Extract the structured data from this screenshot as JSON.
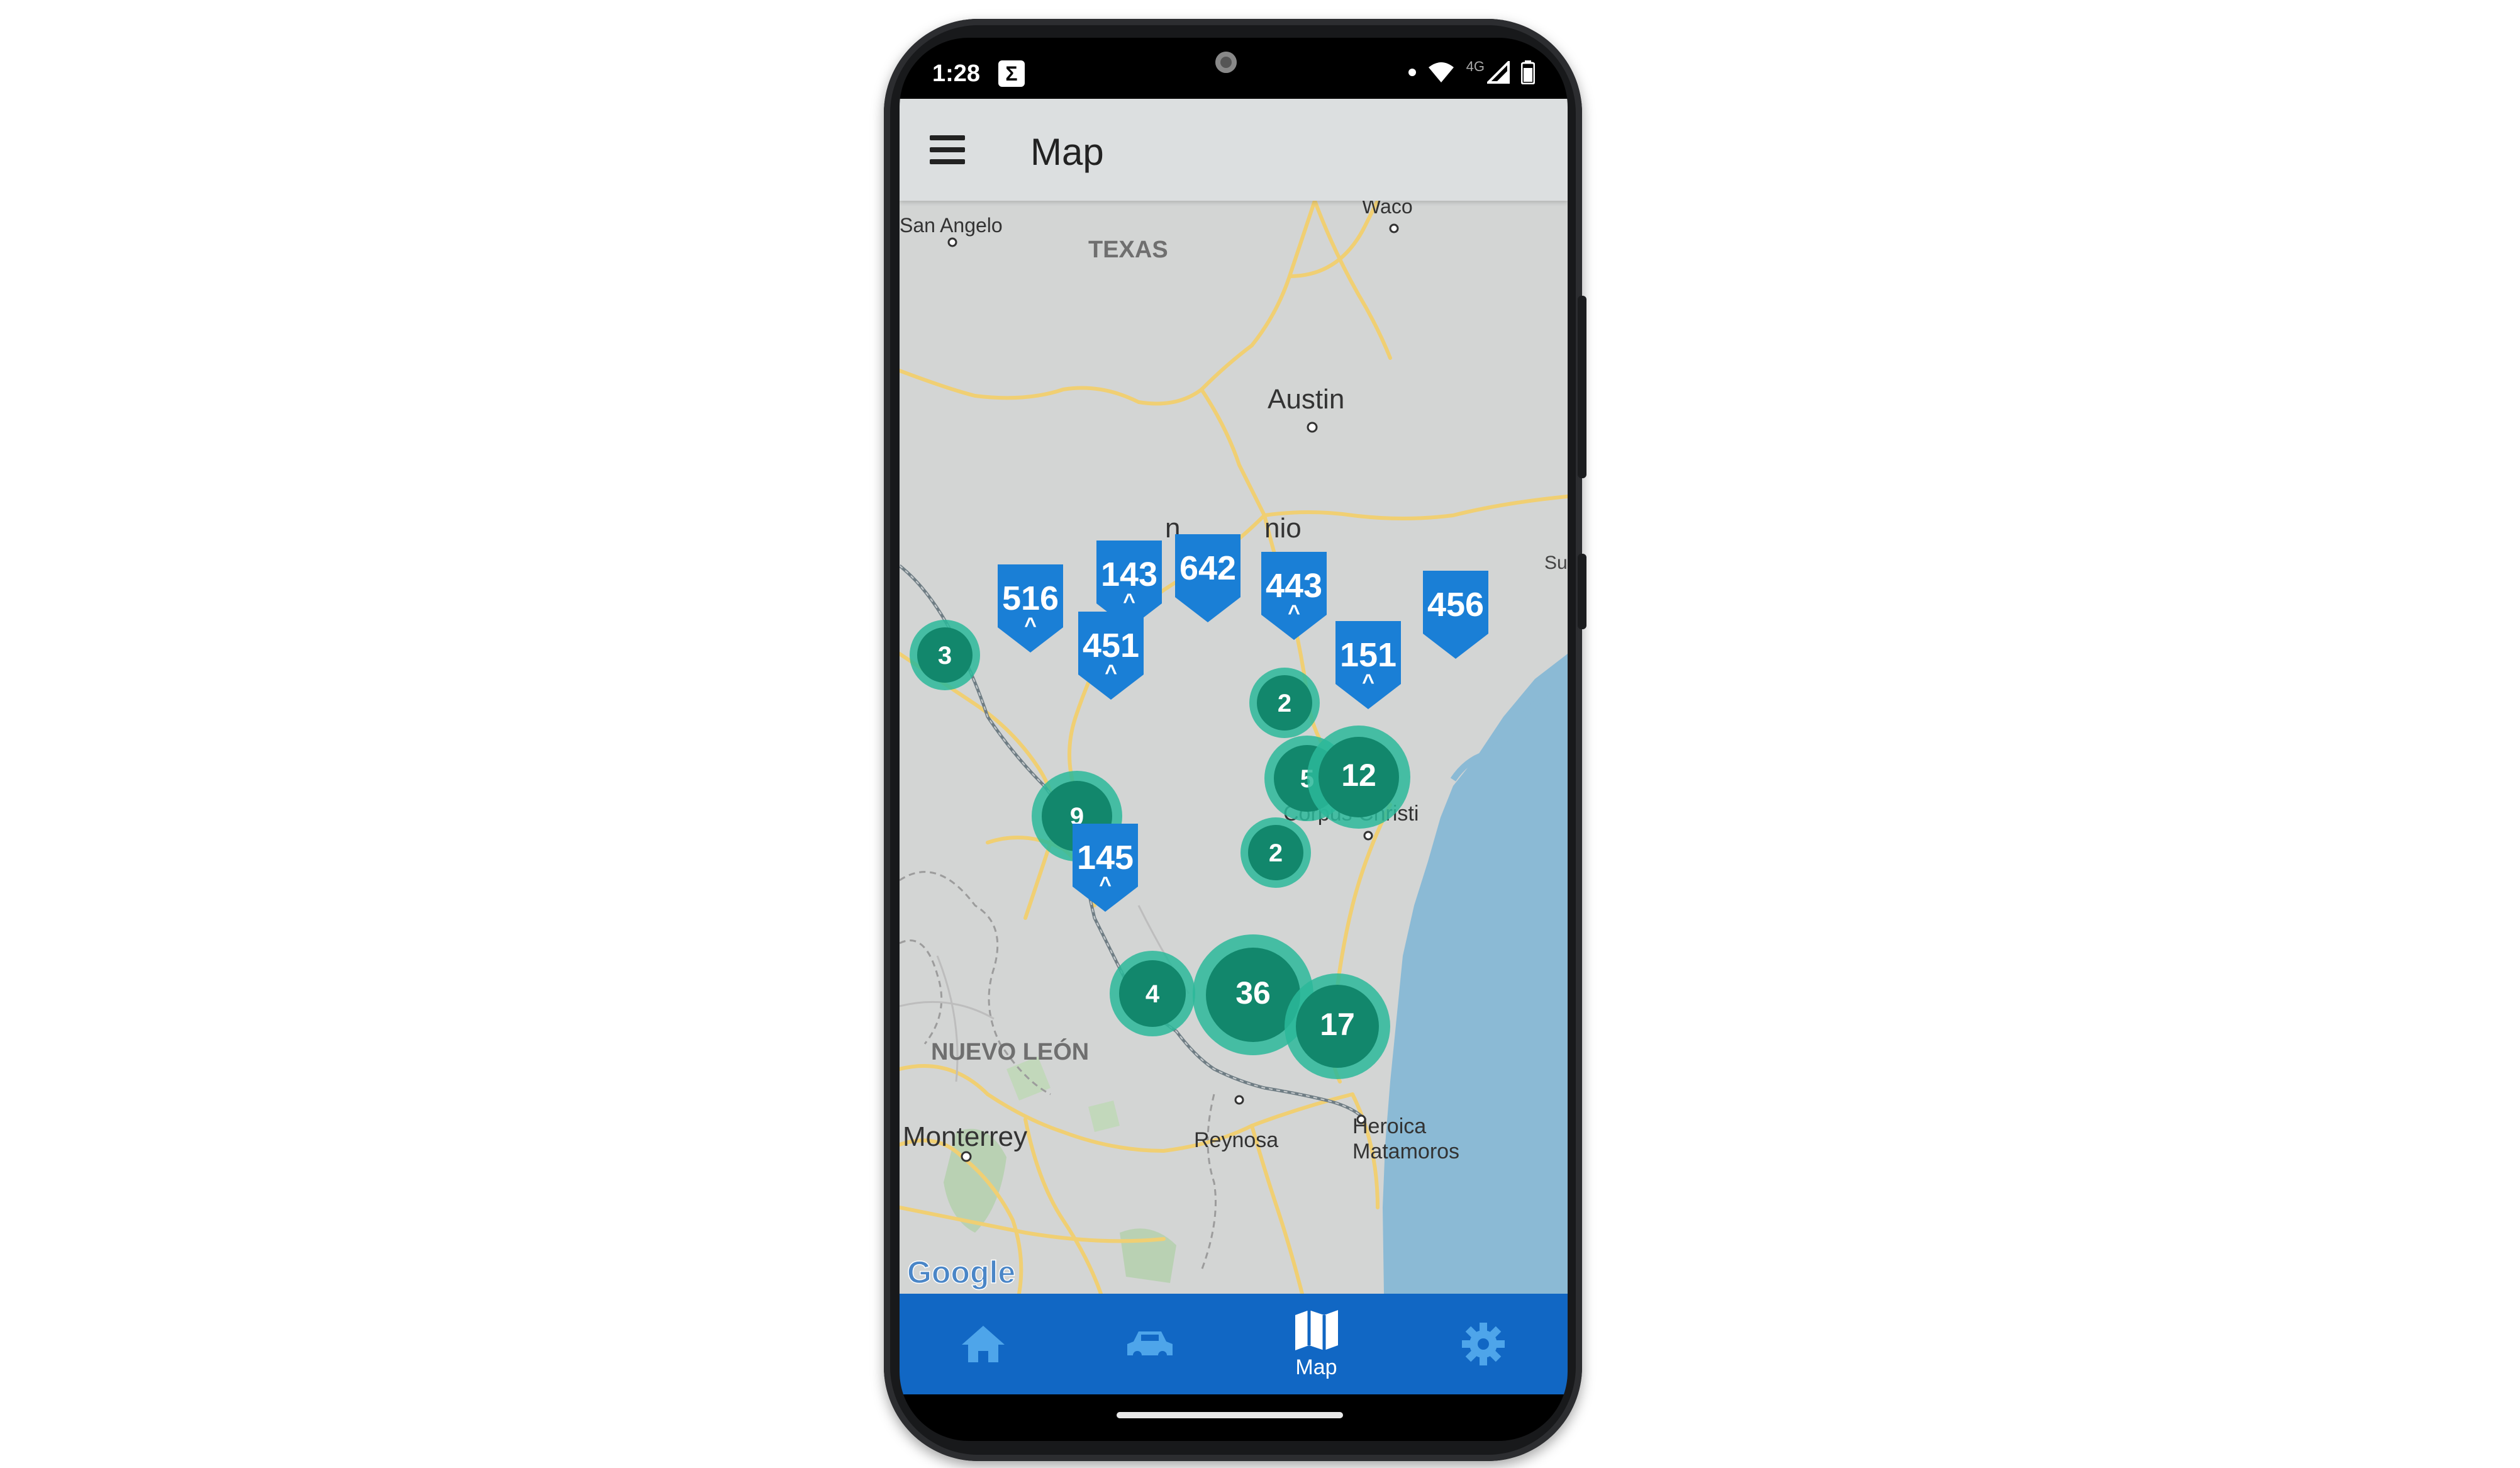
{
  "status_bar": {
    "time": "1:28",
    "app_icon": "Σ",
    "network": "4G"
  },
  "header": {
    "title": "Map",
    "menu_icon": "hamburger-menu-icon"
  },
  "map": {
    "labels": {
      "san_angelo": "San Angelo",
      "waco": "Waco",
      "texas": "TEXAS",
      "austin": "Austin",
      "san_antonio_partial": "n",
      "san_antonio_partial2": "nio",
      "sugar_partial": "Su",
      "corpus_christi": "Corpus Christi",
      "nuevo_leon": "NUEVO LEÓN",
      "monterrey": "Monterrey",
      "reynosa": "Reynosa",
      "heroica": "Heroica",
      "matamoros": "Matamoros",
      "attribution": "Google"
    },
    "pins": [
      {
        "label": "516",
        "sub": "^"
      },
      {
        "label": "143",
        "sub": "^"
      },
      {
        "label": "642",
        "sub": ""
      },
      {
        "label": "443",
        "sub": "^"
      },
      {
        "label": "451",
        "sub": "^"
      },
      {
        "label": "151",
        "sub": "^"
      },
      {
        "label": "456",
        "sub": ""
      },
      {
        "label": "145",
        "sub": "^"
      }
    ],
    "clusters": [
      {
        "count": "3"
      },
      {
        "count": "2"
      },
      {
        "count": "5"
      },
      {
        "count": "12"
      },
      {
        "count": "9"
      },
      {
        "count": "2"
      },
      {
        "count": "4"
      },
      {
        "count": "36"
      },
      {
        "count": "17"
      }
    ],
    "colors": {
      "pin": "#1a7fd6",
      "cluster": "#12876c",
      "cluster_halo": "#2bb99a",
      "water": "#8bbad5",
      "land": "#d3d5d4",
      "road": "#f0cf73"
    }
  },
  "bottom_nav": {
    "items": [
      {
        "icon": "home-icon",
        "label": ""
      },
      {
        "icon": "car-icon",
        "label": ""
      },
      {
        "icon": "map-icon",
        "label": "Map"
      },
      {
        "icon": "gear-icon",
        "label": ""
      }
    ],
    "active_color": "#ffffff",
    "inactive_color": "#4ea5ea"
  }
}
